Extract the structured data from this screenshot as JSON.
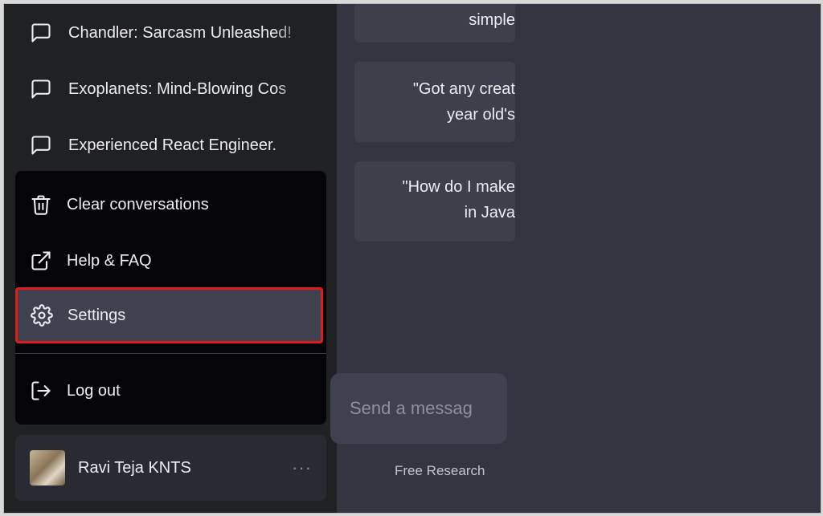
{
  "sidebar": {
    "history": [
      {
        "label": "Chandler: Sarcasm Unleashed!"
      },
      {
        "label": "Exoplanets: Mind-Blowing Cos"
      },
      {
        "label": "Experienced React Engineer."
      }
    ],
    "menu": {
      "clear": "Clear conversations",
      "help": "Help & FAQ",
      "settings": "Settings",
      "logout": "Log out"
    },
    "user": {
      "name": "Ravi Teja KNTS",
      "more": "···"
    }
  },
  "main": {
    "cards": [
      {
        "lines": [
          "simple"
        ]
      },
      {
        "lines": [
          "\"Got any creat",
          "year old's"
        ]
      },
      {
        "lines": [
          "\"How do I make",
          "in Java"
        ]
      }
    ],
    "composer": {
      "placeholder": "Send a messag"
    },
    "footer": "Free Research"
  },
  "colors": {
    "highlight_border": "#e01b1b",
    "sidebar_bg": "#202123",
    "main_bg": "#343541"
  }
}
